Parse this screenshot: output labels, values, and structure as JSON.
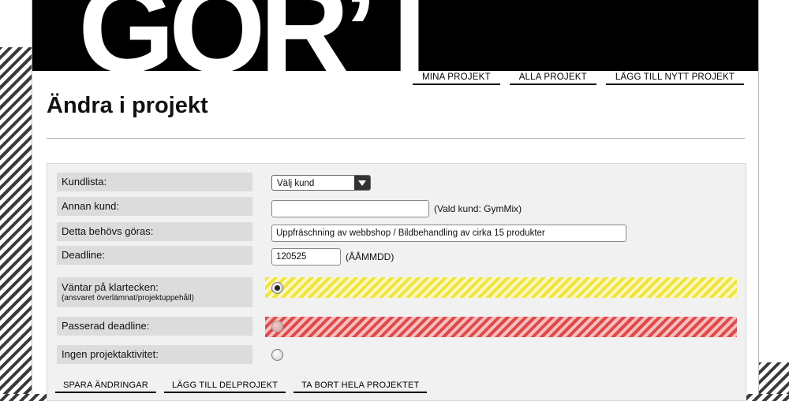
{
  "header": {
    "logo_text": "GÖR’T"
  },
  "topnav": {
    "items": [
      "MINA PROJEKT",
      "ALLA PROJEKT",
      "LÄGG TILL NYTT PROJEKT"
    ]
  },
  "page": {
    "title": "Ändra i projekt"
  },
  "form": {
    "kundlista": {
      "label": "Kundlista:",
      "selected": "Välj kund"
    },
    "annan_kund": {
      "label": "Annan kund:",
      "value": "",
      "note": "(Vald kund: GymMix)"
    },
    "uppgift": {
      "label": "Detta behövs göras:",
      "value": "Uppfräschning av webbshop / Bildbehandling av cirka 15 produkter"
    },
    "deadline": {
      "label": "Deadline:",
      "value": "120525",
      "note": "(ÅÅMMDD)"
    },
    "status": {
      "waiting": {
        "label": "Väntar på klartecken:",
        "sublabel": "(ansvaret överlämnat/projektuppehåll)",
        "selected": true,
        "color": "#f0e43a"
      },
      "passed": {
        "label": "Passerad deadline:",
        "selected": false,
        "color": "#de4a4a"
      },
      "inactive": {
        "label": "Ingen projektaktivitet:",
        "selected": false
      }
    }
  },
  "actions": {
    "save": "SPARA ÄNDRINGAR",
    "add_sub": "LÄGG TILL DELPROJEKT",
    "delete": "TA BORT HELA PROJEKTET"
  }
}
